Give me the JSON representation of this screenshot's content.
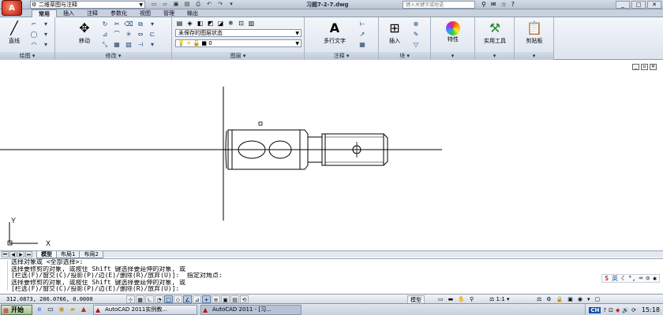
{
  "app": {
    "logo": "A",
    "workspace": "二维草图与注释",
    "document_title": "习题7-2-7.dwg",
    "search_placeholder": "键入关键字或短语"
  },
  "ribbon_tabs": [
    "常用",
    "插入",
    "注释",
    "参数化",
    "视图",
    "管理",
    "输出"
  ],
  "active_tab": "常用",
  "ribbon": {
    "draw": {
      "title": "绘图",
      "line_label": "直线"
    },
    "modify": {
      "title": "修改",
      "move_label": "移动"
    },
    "layers": {
      "title": "图层",
      "state": "未保存的图层状态",
      "current_layer": "0"
    },
    "annotation": {
      "title": "注释",
      "mtext_label": "多行文字"
    },
    "block": {
      "title": "块",
      "insert_label": "插入"
    },
    "properties": {
      "label": "特性"
    },
    "utilities": {
      "label": "实用工具"
    },
    "clipboard": {
      "label": "剪贴板"
    }
  },
  "layout_tabs": [
    "模型",
    "布局1",
    "布局2"
  ],
  "active_layout": "模型",
  "command_lines": [
    "选择对象或 <全部选择>:",
    "选择要修剪的对象, 或按住 Shift 键选择要延伸的对象, 或",
    "[栏选(F)/窗交(C)/投影(P)/边(E)/删除(R)/放弃(U)]:  指定对角点:",
    "选择要修剪的对象, 或按住 Shift 键选择要延伸的对象, 或",
    "[栏选(F)/窗交(C)/投影(P)/边(E)/删除(R)/放弃(U)]:"
  ],
  "ime": {
    "logo": "S",
    "label": "英"
  },
  "status": {
    "coords": "312.0873, 206.0766, 0.0000",
    "space": "模型",
    "scale": "1:1"
  },
  "taskbar": {
    "start": "开始",
    "items": [
      "AutoCAD 2011实例教...",
      "AutoCAD 2011 - [习..."
    ],
    "lang": "CH",
    "time": "15:18"
  },
  "axes": {
    "x": "X",
    "y": "Y"
  }
}
